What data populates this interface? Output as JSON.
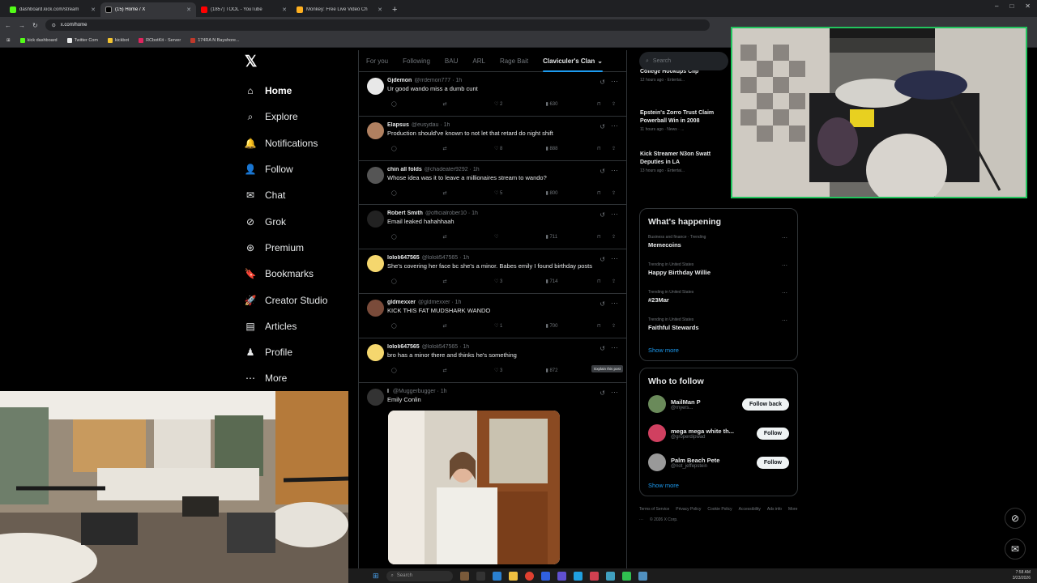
{
  "browser": {
    "tabs": [
      {
        "label": "dashboard.kick.com/stream",
        "active": false,
        "color": "#53fc18"
      },
      {
        "label": "(15) Home / X",
        "active": true,
        "color": "#000000"
      },
      {
        "label": "(1857) TOOL - YouTube",
        "active": false,
        "color": "#ff0000"
      },
      {
        "label": "Monkey: Free Live Video Ch",
        "active": false,
        "color": "#ffb020"
      }
    ],
    "url": "x.com/home",
    "bookmarks": [
      {
        "label": "kick dashboard",
        "color": "#53fc18"
      },
      {
        "label": "Twitter Com",
        "color": "#e7e9ea"
      },
      {
        "label": "kickbot",
        "color": "#f4c430"
      },
      {
        "label": "RCbotKit - Server",
        "color": "#e0245e"
      },
      {
        "label": "174RA N Bayshore...",
        "color": "#c0392b"
      }
    ]
  },
  "nav": {
    "logo": "𝕏",
    "items": [
      {
        "label": "Home",
        "icon": "home-icon",
        "glyph": "⌂",
        "active": true
      },
      {
        "label": "Explore",
        "icon": "search-icon",
        "glyph": "⌕",
        "active": false
      },
      {
        "label": "Notifications",
        "icon": "bell-icon",
        "glyph": "🔔",
        "active": false
      },
      {
        "label": "Follow",
        "icon": "person-plus-icon",
        "glyph": "👤",
        "active": false
      },
      {
        "label": "Chat",
        "icon": "mail-icon",
        "glyph": "✉",
        "active": false
      },
      {
        "label": "Grok",
        "icon": "grok-icon",
        "glyph": "⊘",
        "active": false
      },
      {
        "label": "Premium",
        "icon": "premium-icon",
        "glyph": "⊛",
        "active": false
      },
      {
        "label": "Bookmarks",
        "icon": "bookmark-icon",
        "glyph": "🔖",
        "active": false
      },
      {
        "label": "Creator Studio",
        "icon": "rocket-icon",
        "glyph": "🚀",
        "active": false
      },
      {
        "label": "Articles",
        "icon": "article-icon",
        "glyph": "▤",
        "active": false
      },
      {
        "label": "Profile",
        "icon": "profile-icon",
        "glyph": "♟",
        "active": false
      },
      {
        "label": "More",
        "icon": "more-icon",
        "glyph": "⋯",
        "active": false
      }
    ]
  },
  "feed": {
    "tabs": [
      "For you",
      "Following",
      "BAU",
      "ARL",
      "Rage Bait",
      "Claviculer's Clan"
    ],
    "selected_tab_suffix": "⌄",
    "posts": [
      {
        "name": "Gjdemon",
        "handle": "@rrdemon777 · 1h",
        "text": "Ur good wando miss a dumb cunt",
        "likes": "2",
        "views": "630",
        "avatar": "#e8e8e8"
      },
      {
        "name": "Elapsus",
        "handle": "@eusydau · 1h",
        "text": "Production should've known to not let that retard do night shift",
        "likes": "8",
        "views": "888",
        "avatar": "#b08060"
      },
      {
        "name": "chin all folds",
        "handle": "@chadeater9292 · 1h",
        "text": "Whose idea was it to leave a millionaires stream to wando?",
        "likes": "5",
        "views": "800",
        "avatar": "#555555"
      },
      {
        "name": "Robert Smith",
        "handle": "@officialrober10 · 1h",
        "text": "Email leaked hahahhaah",
        "likes": "",
        "views": "711",
        "avatar": "#222222"
      },
      {
        "name": "lololi647565",
        "handle": "@lololi547565 · 1h",
        "text": "She's covering her face bc she's a minor. Babes emily I found birthday posts",
        "likes": "3",
        "views": "714",
        "avatar": "#f5d76e"
      },
      {
        "name": "gldmexxer",
        "handle": "@gldmexxer · 1h",
        "text": "KICK THIS FAT MUDSHARK WANDO",
        "likes": "1",
        "views": "700",
        "avatar": "#7a4b3a"
      },
      {
        "name": "lololi647565",
        "handle": "@lololi547565 · 1h",
        "text": "bro has a minor there and thinks he's something",
        "likes": "3",
        "views": "872",
        "avatar": "#f5d76e"
      }
    ],
    "tooltip": "Explain this post",
    "last_post": {
      "name": "I",
      "handle": "@Muggerbugger · 1h",
      "text": "Emily Conlin"
    }
  },
  "right": {
    "search_placeholder": "Search",
    "news": [
      {
        "title": "College Hookups Clip",
        "meta": "12 hours ago · Entertai..."
      },
      {
        "title": "Epstein's Zorro Trust Claim Powerball Win in 2008",
        "meta": "11 hours ago · News · ..."
      },
      {
        "title": "Kick Streamer N3on Swatt Deputies in LA",
        "meta": "13 hours ago · Entertai..."
      }
    ],
    "happening": {
      "title": "What's happening",
      "trends": [
        {
          "meta": "Business and finance · Trending",
          "topic": "Memecoins"
        },
        {
          "meta": "Trending in United States",
          "topic": "Happy Birthday Willie"
        },
        {
          "meta": "Trending in United States",
          "topic": "#23Mar"
        },
        {
          "meta": "Trending in United States",
          "topic": "Faithful Stewards"
        }
      ],
      "show_more": "Show more"
    },
    "who_to_follow": {
      "title": "Who to follow",
      "people": [
        {
          "name": "MailMan P",
          "handle": "@myers...",
          "button": "Follow back",
          "avatar": "#6a8a5a"
        },
        {
          "name": "mega mega white th...",
          "handle": "@groperdipwad",
          "button": "Follow",
          "avatar": "#d04060"
        },
        {
          "name": "Palm Beach Pete",
          "handle": "@not_jeffepstein",
          "button": "Follow",
          "avatar": "#999999"
        }
      ],
      "show_more": "Show more"
    },
    "footer": [
      "Terms of Service",
      "Privacy Policy",
      "Cookie Policy",
      "Accessibility",
      "Ads info",
      "More ···",
      "© 2026 X Corp."
    ]
  },
  "taskbar": {
    "search_placeholder": "Search",
    "time": "7:58 AM",
    "date": "3/23/2026"
  },
  "colors": {
    "accent": "#1d9bf0",
    "cam_border": "#22c55e"
  }
}
